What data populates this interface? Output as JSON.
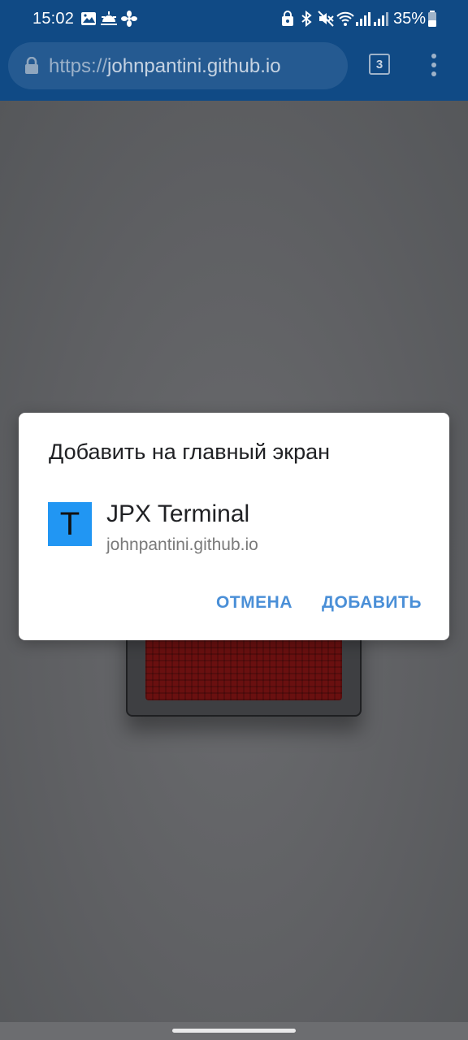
{
  "status_bar": {
    "time": "15:02",
    "battery_percent": "35%",
    "left_icons": [
      "gallery-icon",
      "weather-icon",
      "fan-icon"
    ],
    "right_icons": [
      "vpn-lock-icon",
      "bluetooth-icon",
      "mute-icon",
      "wifi-icon",
      "signal-icon",
      "signal-icon",
      "battery-icon"
    ]
  },
  "browser": {
    "url_scheme": "https://",
    "url_host": "johnpantini.github.io",
    "tab_count": "3"
  },
  "dialog": {
    "title": "Добавить на главный экран",
    "app_icon_letter": "T",
    "app_icon_color": "#2196f3",
    "app_name": "JPX Terminal",
    "app_url": "johnpantini.github.io",
    "cancel_label": "ОТМЕНА",
    "add_label": "ДОБАВИТЬ",
    "accent_color": "#4a8fd7"
  }
}
